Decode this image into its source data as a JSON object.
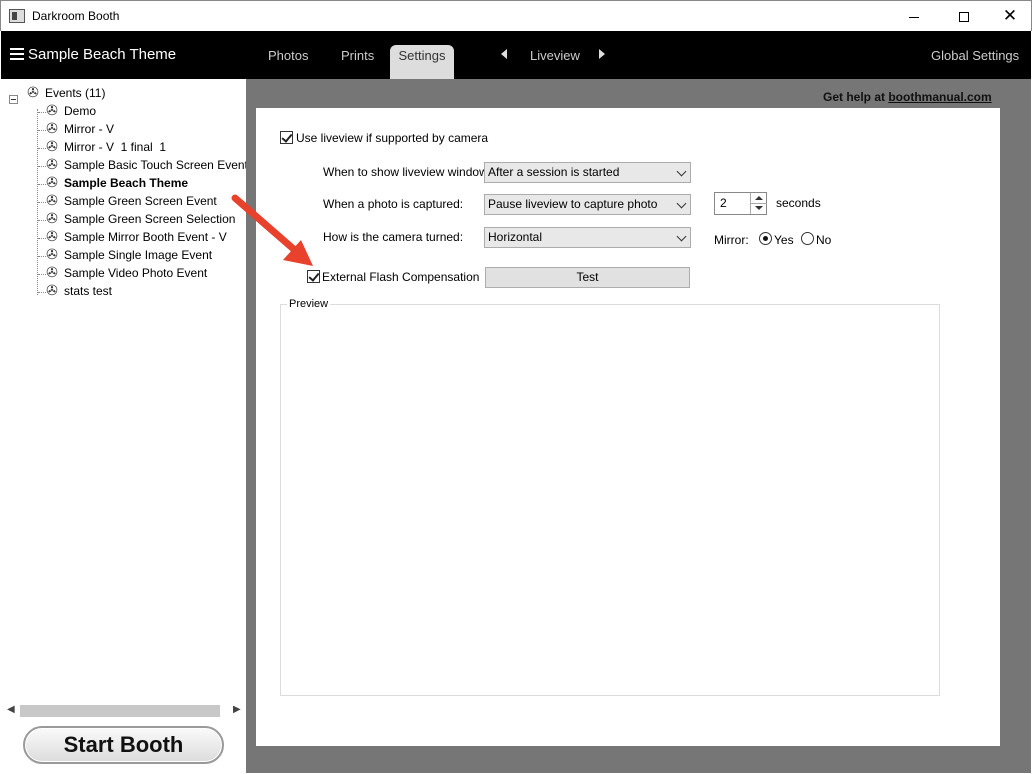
{
  "window": {
    "title": "Darkroom Booth",
    "minimize_label": "",
    "close_label": "✕"
  },
  "topbar": {
    "theme_title": "Sample Beach Theme",
    "tabs": [
      {
        "label": "Photos"
      },
      {
        "label": "Prints"
      },
      {
        "label": "Settings",
        "active": true
      },
      {
        "label": "Liveview"
      }
    ],
    "global_settings_label": "Global Settings"
  },
  "tree": {
    "root_label": "Events (11)",
    "items": [
      {
        "label": "Demo"
      },
      {
        "label": "Mirror - V"
      },
      {
        "label": "Mirror - V  1 final  1"
      },
      {
        "label": "Sample Basic Touch Screen Event"
      },
      {
        "label": "Sample Beach Theme",
        "selected": true
      },
      {
        "label": "Sample Green Screen Event"
      },
      {
        "label": "Sample Green Screen Selection"
      },
      {
        "label": "Sample Mirror Booth Event - V"
      },
      {
        "label": "Sample Single Image Event"
      },
      {
        "label": "Sample Video Photo Event"
      },
      {
        "label": "stats test"
      }
    ]
  },
  "start_booth_label": "Start Booth",
  "help": {
    "prefix": "Get help at ",
    "link": "boothmanual.com"
  },
  "settings": {
    "use_liveview_label": "Use liveview if supported by camera",
    "use_liveview_checked": true,
    "when_show_label": "When to show liveview window:",
    "when_show_value": "After a session is started",
    "when_captured_label": "When a photo is captured:",
    "when_captured_value": "Pause liveview to capture photo",
    "seconds_value": "2",
    "seconds_label": "seconds",
    "camera_turned_label": "How is the camera turned:",
    "camera_turned_value": "Horizontal",
    "mirror_label": "Mirror:",
    "mirror_yes_label": "Yes",
    "mirror_no_label": "No",
    "mirror_selected": "Yes",
    "external_flash_label": "External Flash Compensation",
    "external_flash_checked": true,
    "test_button_label": "Test",
    "preview_label": "Preview"
  },
  "colors": {
    "topbar_bg": "#000000",
    "right_bg": "#767676",
    "annotation_arrow": "#e8412c"
  },
  "icons": {
    "event_node": "film-reel-icon",
    "menu": "hamburger-menu-icon"
  }
}
